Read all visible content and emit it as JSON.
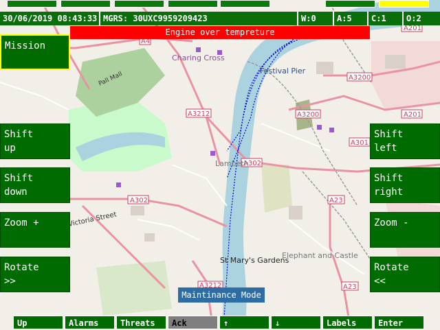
{
  "status_bar": {
    "datetime": "30/06/2019 08:43:33",
    "mgrs": "MGRS: 30UXC9959209423",
    "w": "W:0",
    "a": "A:5",
    "c": "C:1",
    "o": "O:2"
  },
  "alert": "Engine over tempreture",
  "left_buttons": {
    "mission": "Mission",
    "shift_up_1": "Shift",
    "shift_up_2": "up",
    "shift_down_1": "Shift",
    "shift_down_2": "down",
    "zoom_in": "Zoom +",
    "rotate_right_1": "Rotate",
    "rotate_right_2": ">>"
  },
  "right_buttons": {
    "shift_left_1": "Shift",
    "shift_left_2": "left",
    "shift_right_1": "Shift",
    "shift_right_2": "right",
    "zoom_out": "Zoom -",
    "rotate_left_1": "Rotate",
    "rotate_left_2": "<<"
  },
  "mode": "Maintinance Mode",
  "bottom_buttons": {
    "up": "Up",
    "alarms": "Alarms",
    "threats": "Threats",
    "ack": "Ack",
    "arrow_up": "↑",
    "arrow_down": "↓",
    "labels": "Labels",
    "enter": "Enter"
  },
  "map_labels": {
    "charing_cross": "Charing Cross",
    "festival_pier": "Festival Pier",
    "pall_mall": "Pall Mall",
    "victoria_street": "Victoria Street",
    "lambeth": "Lambeth",
    "st_marys": "St Mary's Gardens",
    "elephant": "Elephant and Castle"
  },
  "road_labels": {
    "a4": "A4",
    "a3212": "A3212",
    "a302_top": "A302",
    "a302_left": "A302",
    "a3200_top": "A3200",
    "a3200": "A3200",
    "a301": "A301",
    "a201_top": "A201",
    "a201": "A201",
    "a23_mid": "A23",
    "a23_bottom": "A23",
    "a3212_bottom": "A3212"
  },
  "colors": {
    "button_green": "#006b00",
    "status_green": "#0a6f0a",
    "alert_red": "#ff0000",
    "highlight_yellow": "#ffff00",
    "river_blue": "#aad3df",
    "mode_blue": "#2e6da3"
  }
}
